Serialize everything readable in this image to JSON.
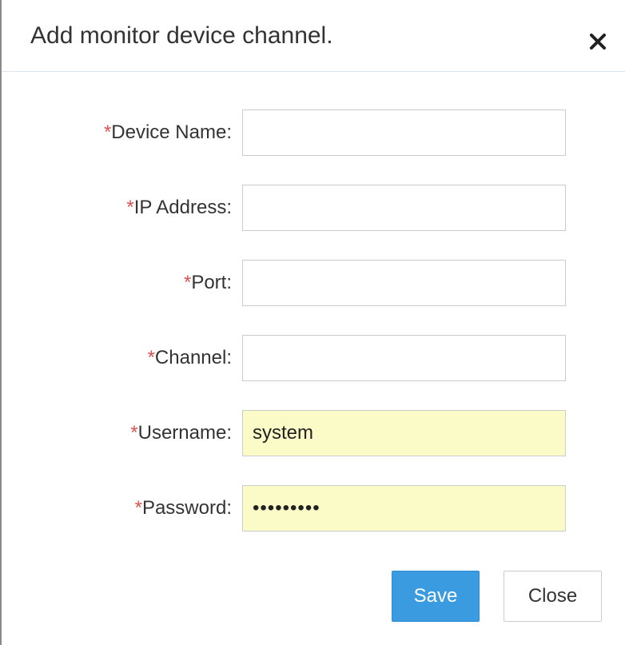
{
  "dialog": {
    "title": "Add monitor device channel.",
    "close_icon": "close-icon"
  },
  "form": {
    "required_marker": "*",
    "fields": [
      {
        "label": "Device Name:",
        "value": "",
        "type": "text"
      },
      {
        "label": "IP Address:",
        "value": "",
        "type": "text"
      },
      {
        "label": "Port:",
        "value": "",
        "type": "text"
      },
      {
        "label": "Channel:",
        "value": "",
        "type": "text"
      },
      {
        "label": "Username:",
        "value": "system",
        "type": "text"
      },
      {
        "label": "Password:",
        "value": "•••••••••",
        "type": "password"
      }
    ]
  },
  "buttons": {
    "save_label": "Save",
    "close_label": "Close"
  },
  "colors": {
    "accent": "#3a9be0",
    "required": "#d9534f",
    "autofill": "#fafbc6"
  }
}
